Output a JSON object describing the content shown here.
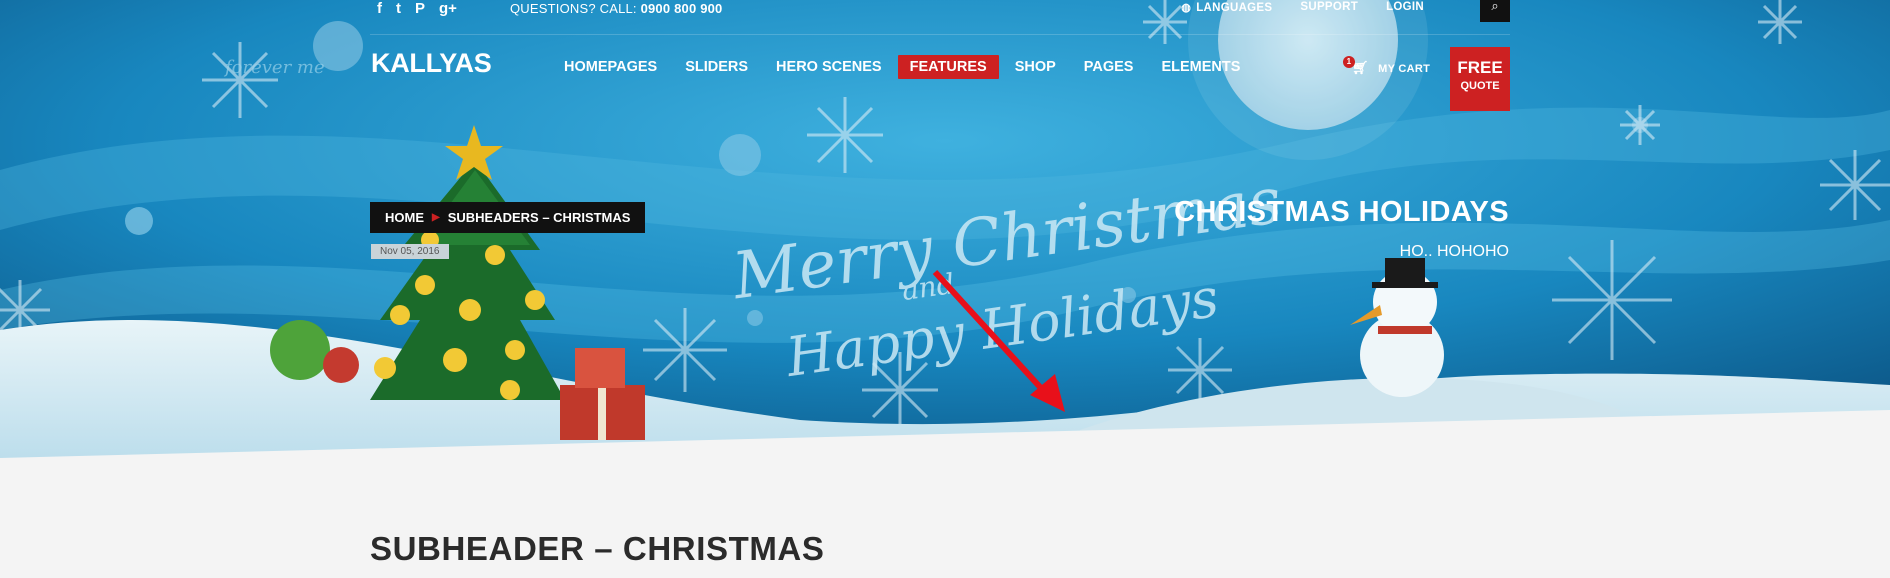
{
  "topbar": {
    "social": [
      "f",
      "t",
      "P",
      "g+"
    ],
    "questions_label": "QUESTIONS? CALL:",
    "phone": "0900 800 900",
    "links": {
      "languages": "LANGUAGES",
      "support": "SUPPORT",
      "login": "LOGIN"
    },
    "search_icon": "⌕"
  },
  "header": {
    "logo": "KALLYAS",
    "nav": [
      "HOMEPAGES",
      "SLIDERS",
      "HERO SCENES",
      "FEATURES",
      "SHOP",
      "PAGES",
      "ELEMENTS"
    ],
    "active_nav": "FEATURES",
    "cart": {
      "count": "1",
      "label": "MY CART"
    },
    "quote": {
      "line1": "FREE",
      "line2": "QUOTE"
    }
  },
  "hero": {
    "breadcrumb": [
      "HOME",
      "SUBHEADERS – CHRISTMAS"
    ],
    "date": "Nov 05, 2016",
    "title": "CHRISTMAS HOLIDAYS",
    "subtitle": "HO.. HOHOHO",
    "image_text": {
      "line1": "Merry Christmas",
      "line2": "and",
      "line3": "Happy Holidays",
      "signature": "forever me"
    }
  },
  "content": {
    "title": "SUBHEADER – CHRISTMAS"
  },
  "colors": {
    "accent": "#cd2122",
    "hero_blue": "#1d8fc4",
    "dark": "#111111",
    "page_bg": "#f4f4f4"
  }
}
